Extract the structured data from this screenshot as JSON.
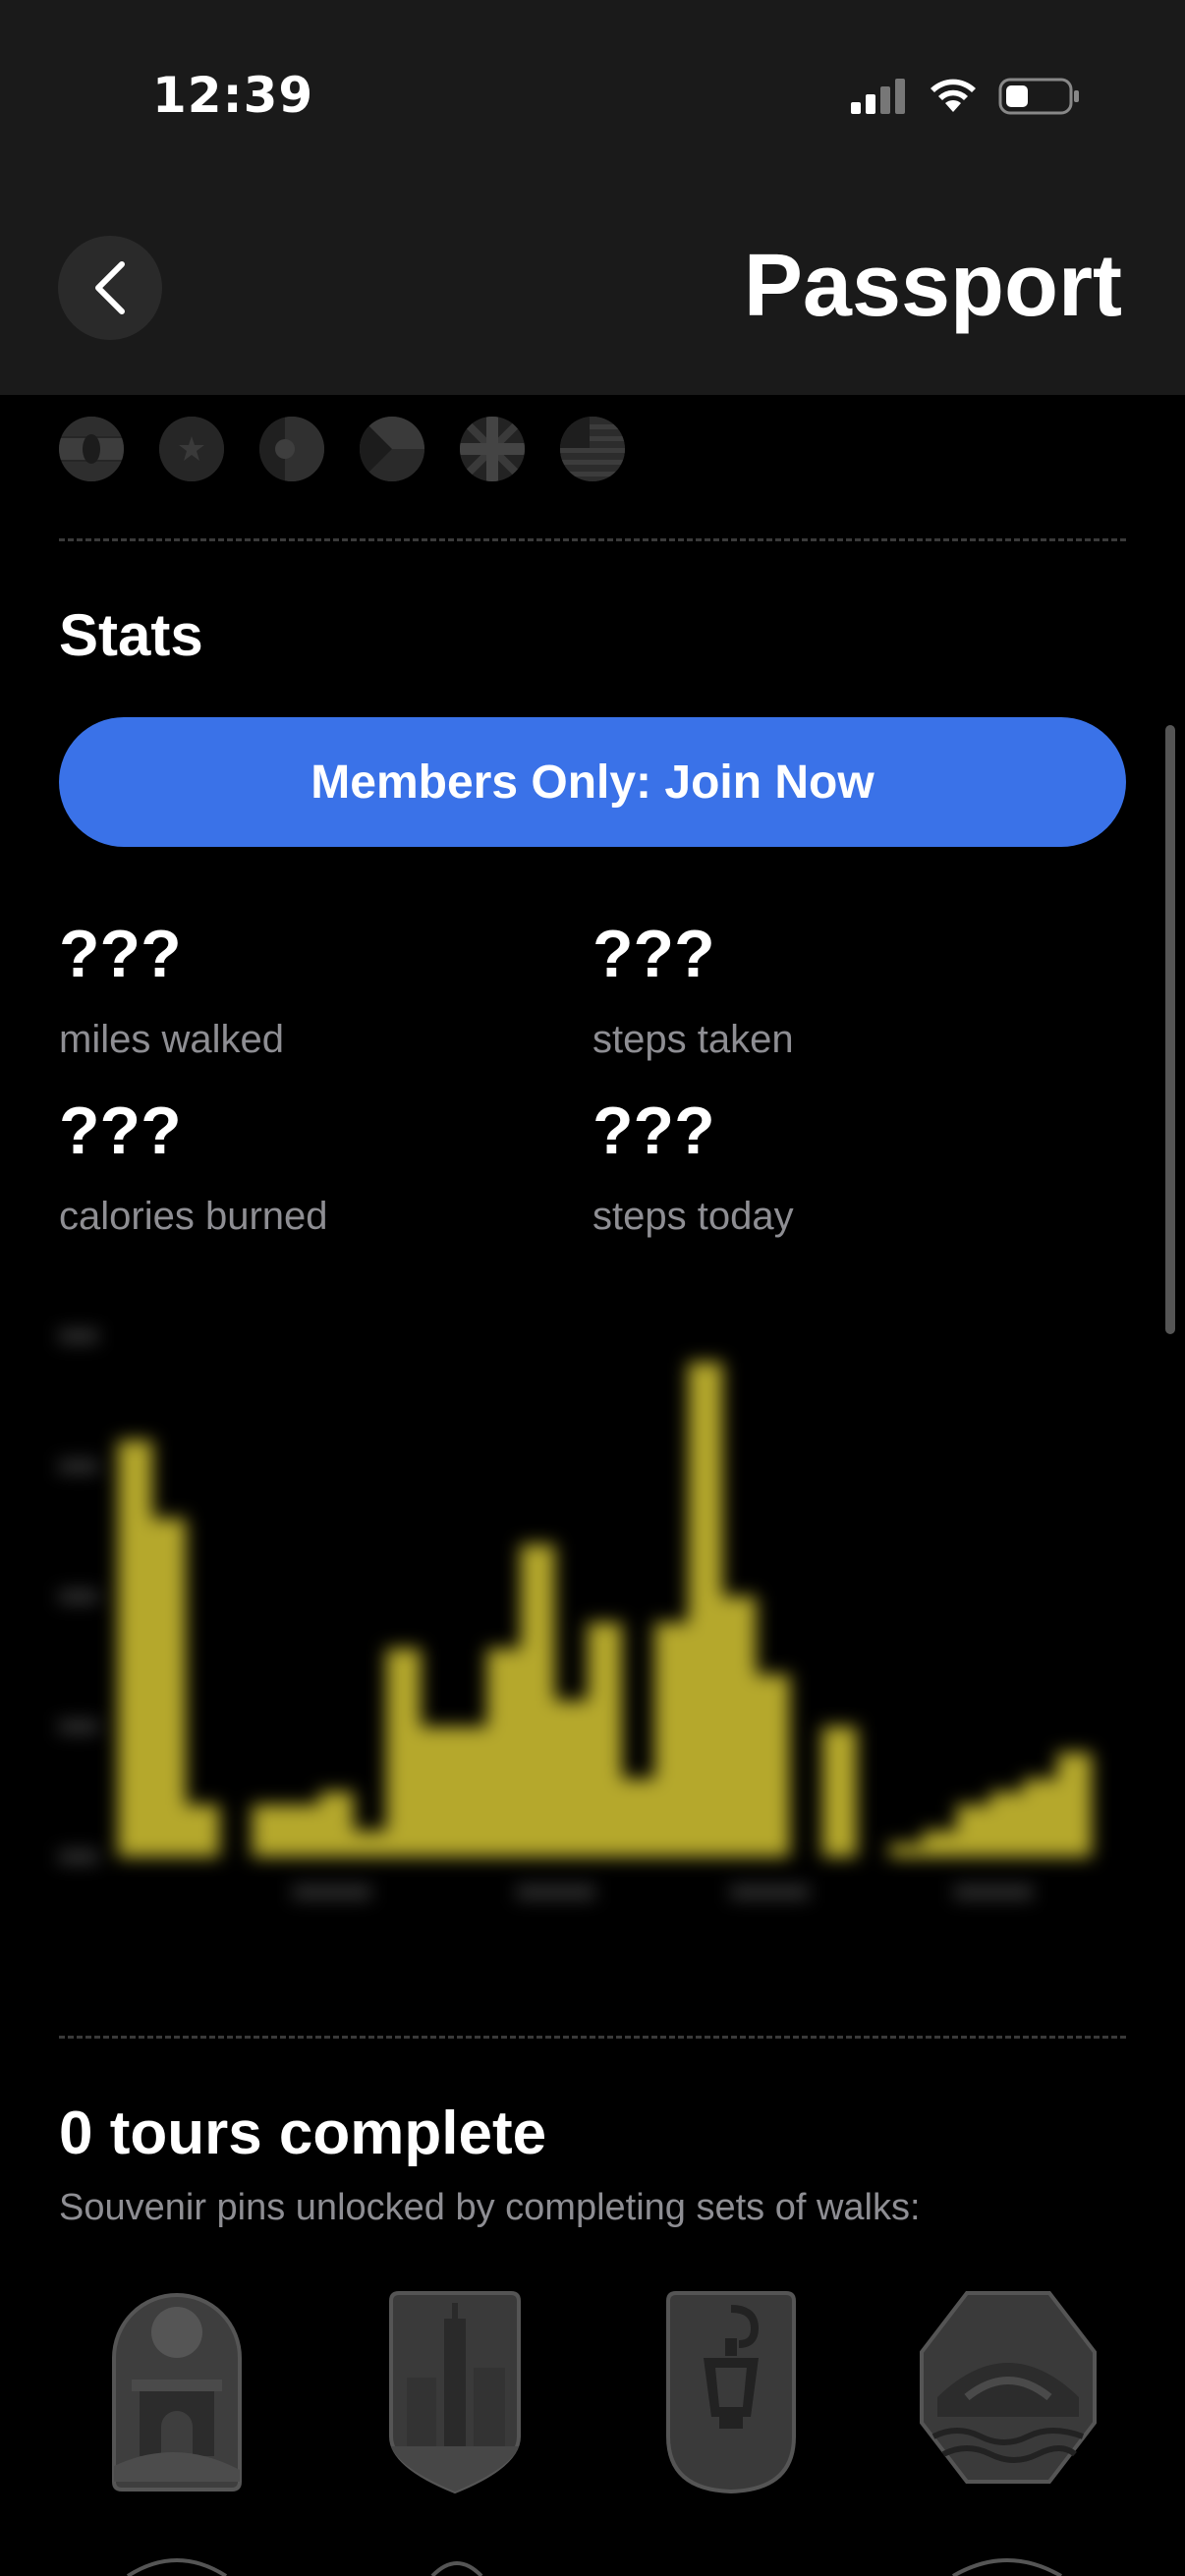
{
  "status_bar": {
    "time": "12:39"
  },
  "header": {
    "title": "Passport"
  },
  "flags": [
    {
      "name": "kenya-flag-icon"
    },
    {
      "name": "vietnam-flag-icon"
    },
    {
      "name": "portugal-flag-icon"
    },
    {
      "name": "czech-flag-icon"
    },
    {
      "name": "uk-flag-icon"
    },
    {
      "name": "usa-flag-icon"
    }
  ],
  "stats": {
    "title": "Stats",
    "join_label": "Members Only: Join Now",
    "items": [
      {
        "value": "???",
        "label": "miles walked"
      },
      {
        "value": "???",
        "label": "steps taken"
      },
      {
        "value": "???",
        "label": "calories burned"
      },
      {
        "value": "???",
        "label": "steps today"
      }
    ]
  },
  "chart_data": {
    "type": "bar",
    "blurred": true,
    "bar_color": "#b5a82c",
    "ylim": [
      0,
      20000
    ],
    "values": [
      16000,
      13000,
      2000,
      0,
      2000,
      2000,
      2500,
      1000,
      8000,
      5000,
      5000,
      8000,
      12000,
      6000,
      9000,
      3000,
      9000,
      19000,
      10000,
      7000,
      0,
      5000,
      0,
      500,
      1000,
      2000,
      2500,
      3000,
      4000
    ]
  },
  "tours": {
    "title": "0 tours complete",
    "subtitle": "Souvenir pins unlocked by completing sets of walks:",
    "pins": [
      {
        "name": "paris-arc-pin-icon"
      },
      {
        "name": "nyc-skyline-pin-icon"
      },
      {
        "name": "london-lamp-pin-icon"
      },
      {
        "name": "venice-bridge-pin-icon"
      }
    ]
  },
  "colors": {
    "accent": "#3a72e8",
    "background": "#000000",
    "header": "#1a1a1a",
    "secondary_text": "#8e8e93"
  }
}
